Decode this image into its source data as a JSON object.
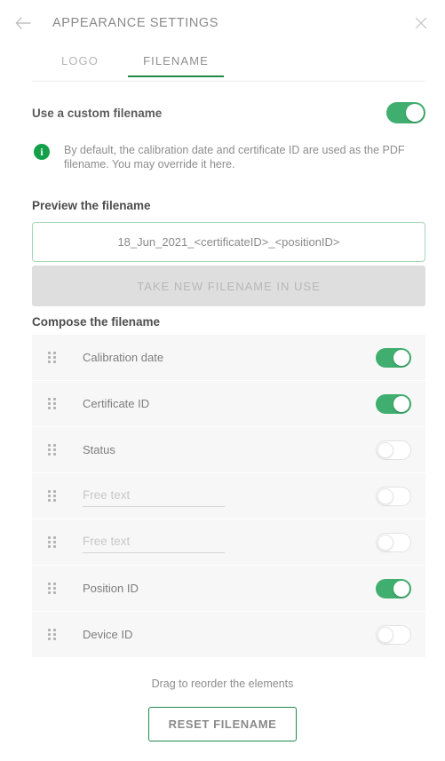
{
  "header": {
    "title": "APPEARANCE SETTINGS",
    "back_icon": "arrow-left-icon",
    "close_icon": "close-icon"
  },
  "tabs": [
    {
      "label": "LOGO",
      "active": false
    },
    {
      "label": "FILENAME",
      "active": true
    }
  ],
  "custom_filename": {
    "label": "Use a custom filename",
    "enabled": true
  },
  "info": {
    "icon": "info-icon",
    "text": "By default, the calibration date and certificate ID are used as the PDF filename. You may override it here."
  },
  "preview": {
    "title": "Preview the filename",
    "value": "18_Jun_2021_<certificateID>_<positionID>",
    "placeholder": "Filename preview"
  },
  "take_in_use": {
    "label": "TAKE NEW FILENAME IN USE",
    "disabled": true
  },
  "compose": {
    "title": "Compose the filename",
    "rows": [
      {
        "label": "Calibration date",
        "type": "label",
        "enabled": true
      },
      {
        "label": "Certificate ID",
        "type": "label",
        "enabled": true
      },
      {
        "label": "Status",
        "type": "label",
        "enabled": false
      },
      {
        "label": "",
        "placeholder": "Free text",
        "type": "input",
        "enabled": false
      },
      {
        "label": "",
        "placeholder": "Free text",
        "type": "input",
        "enabled": false
      },
      {
        "label": "Position ID",
        "type": "label",
        "enabled": true
      },
      {
        "label": "Device ID",
        "type": "label",
        "enabled": false
      }
    ]
  },
  "footer": {
    "hint": "Drag to reorder the elements",
    "reset_label": "RESET FILENAME"
  },
  "colors": {
    "accent_green": "#3fae6e",
    "tab_underline": "#1f8a4c",
    "info_green": "#14a04a",
    "preview_border": "#a5d6b5",
    "row_bg": "#f7f7f7",
    "disabled_btn": "#dedede"
  }
}
